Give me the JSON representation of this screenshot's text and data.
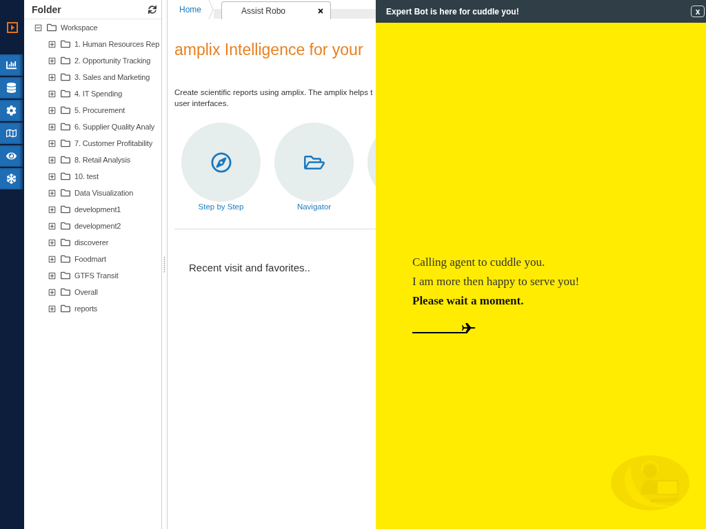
{
  "folder_panel": {
    "title": "Folder",
    "tree": [
      {
        "label": "Workspace",
        "expanded": true,
        "children": [
          {
            "label": "1. Human Resources Rep",
            "expanded": false
          },
          {
            "label": "2. Opportunity Tracking",
            "expanded": false
          },
          {
            "label": "3. Sales and Marketing",
            "expanded": false
          },
          {
            "label": "4. IT Spending",
            "expanded": false
          },
          {
            "label": "5. Procurement",
            "expanded": false
          },
          {
            "label": "6. Supplier Quality Analy",
            "expanded": false
          },
          {
            "label": "7. Customer Profitability",
            "expanded": false
          },
          {
            "label": "8. Retail Analysis",
            "expanded": false
          },
          {
            "label": "10. test",
            "expanded": false
          },
          {
            "label": "Data Visualization",
            "expanded": false
          },
          {
            "label": "development1",
            "expanded": false
          },
          {
            "label": "development2",
            "expanded": false
          },
          {
            "label": "discoverer",
            "expanded": false
          },
          {
            "label": "Foodmart",
            "expanded": false
          },
          {
            "label": "GTFS Transit",
            "expanded": false
          },
          {
            "label": "Overall",
            "expanded": false
          },
          {
            "label": "reports",
            "expanded": false
          }
        ]
      }
    ]
  },
  "tabs": [
    {
      "label": "Home",
      "selected": false,
      "closable": false
    },
    {
      "label": "Assist Robo",
      "selected": true,
      "closable": true
    }
  ],
  "main": {
    "heading": "amplix Intelligence for your",
    "description": [
      "Create scientific reports using amplix. The amplix helps t",
      "user interfaces."
    ],
    "tiles": [
      {
        "kind": "compass",
        "label": "Step by Step"
      },
      {
        "kind": "folder",
        "label": "Navigator"
      }
    ],
    "recent_title": "Recent visit and favorites.."
  },
  "chat": {
    "title": "Expert Bot is here for cuddle you!",
    "close_label": "x",
    "messages": [
      {
        "text": "Calling agent to cuddle you.",
        "bold": false
      },
      {
        "text": "I am more then happy to serve you!",
        "bold": false
      },
      {
        "text": "Please wait a moment.",
        "bold": true
      }
    ]
  }
}
